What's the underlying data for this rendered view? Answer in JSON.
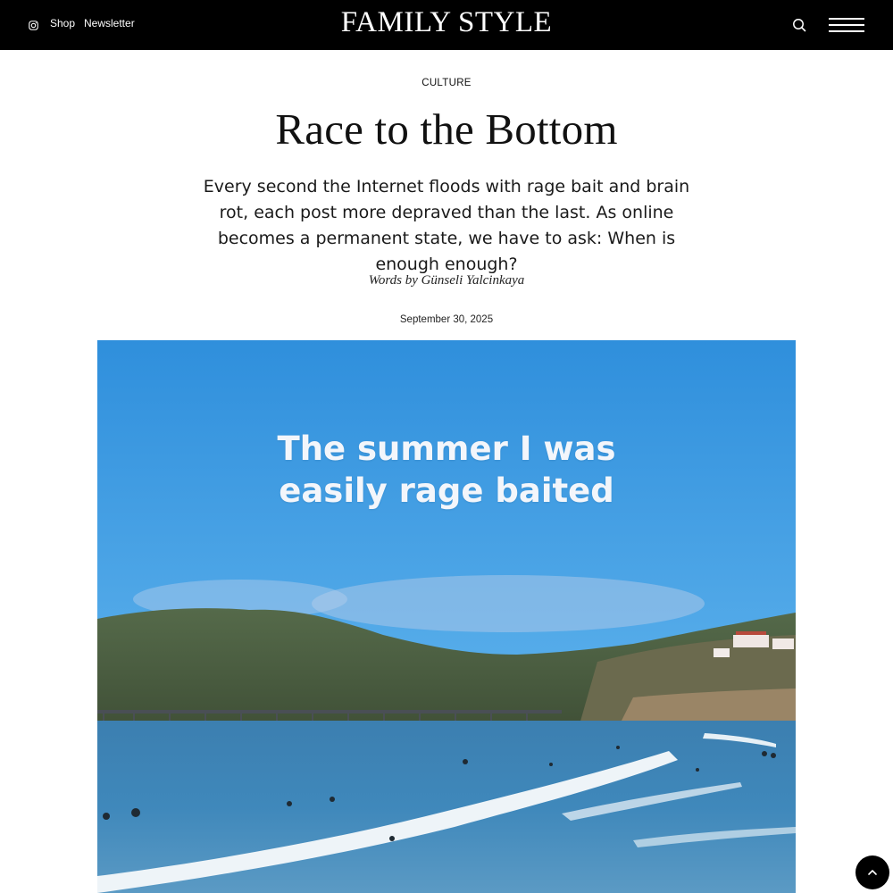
{
  "header": {
    "instagram_icon": "instagram-icon",
    "shop_label": "Shop",
    "newsletter_label": "Newsletter",
    "logo_text": "FAMILY STYLE",
    "search_icon": "search-icon",
    "menu_icon": "hamburger-menu-icon",
    "background_color": "#000000"
  },
  "article": {
    "category": "CULTURE",
    "title": "Race to the Bottom",
    "dek": "Every second the Internet floods with rage bait and brain rot, each post more depraved than the last. As online becomes a permanent state, we have to ask: When is enough enough?",
    "byline": "Words by Günseli Yalcinkaya",
    "date": "September 30, 2025"
  },
  "hero": {
    "caption_line_1": "The summer I was",
    "caption_line_2": "easily rage baited",
    "sky_color": "#3a9be0",
    "sea_color": "#3e86b8"
  },
  "back_to_top": {
    "icon": "chevron-up-icon"
  }
}
